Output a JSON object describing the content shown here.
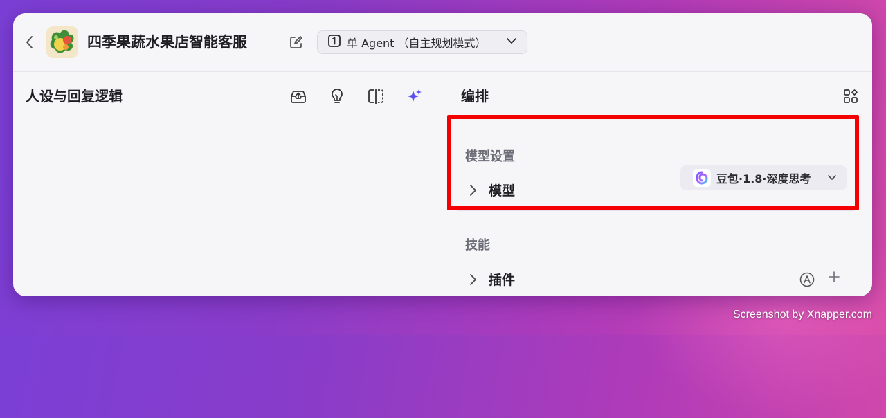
{
  "header": {
    "back_icon": "chevron-left-icon",
    "app_title": "四季果蔬水果店智能客服",
    "edit_icon": "edit-icon",
    "mode_selector": {
      "icon": "single-agent-icon",
      "label": "单 Agent （自主规划模式）"
    }
  },
  "left_panel": {
    "title": "人设与回复逻辑",
    "tools": [
      "inbox-upload-icon",
      "lightbulb-icon",
      "split-view-icon",
      "sparkle-icon"
    ],
    "accent_color": "#5b4df0"
  },
  "right_panel": {
    "title": "编排",
    "arrange_icon": "grid-layout-icon",
    "sections": [
      {
        "label": "模型设置",
        "rows": [
          {
            "label": "模型",
            "value": "豆包·1.8·深度思考"
          }
        ]
      },
      {
        "label": "技能",
        "rows": [
          {
            "label": "插件"
          }
        ]
      }
    ],
    "highlight_color": "#f40000"
  },
  "watermark": "Screenshot by Xnapper.com"
}
